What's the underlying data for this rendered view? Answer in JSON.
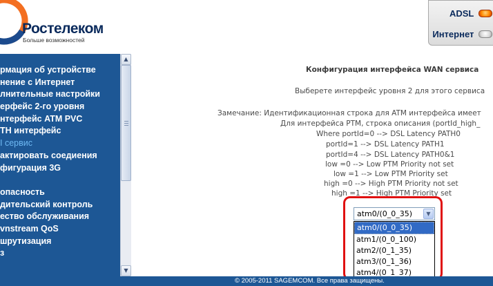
{
  "header": {
    "brand_name": "Ростелеком",
    "brand_slogan": "Больше возможностей",
    "status": {
      "adsl_label": "ADSL",
      "internet_label": "Интернет",
      "adsl_led": "on",
      "internet_led": "off",
      "led_on_color": "#ff8a00",
      "led_off_color": "#d8d8d8"
    }
  },
  "sidebar": {
    "items": [
      {
        "label": "рмация об устройстве"
      },
      {
        "label": "нение с Интернет"
      },
      {
        "label": "лнительные настройки"
      },
      {
        "label": "ерфейс 2-го уровня"
      },
      {
        "label": "нтерфейс ATM PVC"
      },
      {
        "label": "TH интерфейс"
      },
      {
        "label": "I сервис",
        "active": true
      },
      {
        "label": "актировать соедиения"
      },
      {
        "label": "фигурация 3G"
      },
      {
        "label": "опасность"
      },
      {
        "label": "дительский контроль"
      },
      {
        "label": "ество обслуживания"
      },
      {
        "label": "vnstream QoS"
      },
      {
        "label": "шрутизация"
      },
      {
        "label": "з"
      }
    ],
    "active_color": "#6eb9f4",
    "background_color": "#1d5795"
  },
  "main": {
    "title": "Конфигурация интерфейса WAN сервиса",
    "subtitle": "Выберете интерфейс уровня 2 для этого сервиса",
    "note_lines": [
      "Замечание: Идентификационная строка для ATM интерфейса имеет",
      "Для интерфейса PTM, строка описания (portId_high_",
      "Where portId=0 --> DSL Latency PATH0",
      "portId=1 --> DSL Latency PATH1",
      "portId=4 --> DSL Latency PATH0&1",
      "low =0 --> Low PTM Priority not set",
      "low =1 --> Low PTM Priority set",
      "high =0 --> High PTM Priority not set",
      "high =1 --> High PTM Priority set"
    ],
    "interface_select": {
      "selected": "atm0/(0_0_35)",
      "options": [
        "atm0/(0_0_35)",
        "atm1/(0_0_100)",
        "atm2/(0_1_35)",
        "atm3/(0_1_36)",
        "atm4/(0_1_37)"
      ],
      "highlight_color": "#e01010"
    }
  },
  "footer": {
    "text": "© 2005-2011 SAGEMCOM. Все права защищены."
  }
}
